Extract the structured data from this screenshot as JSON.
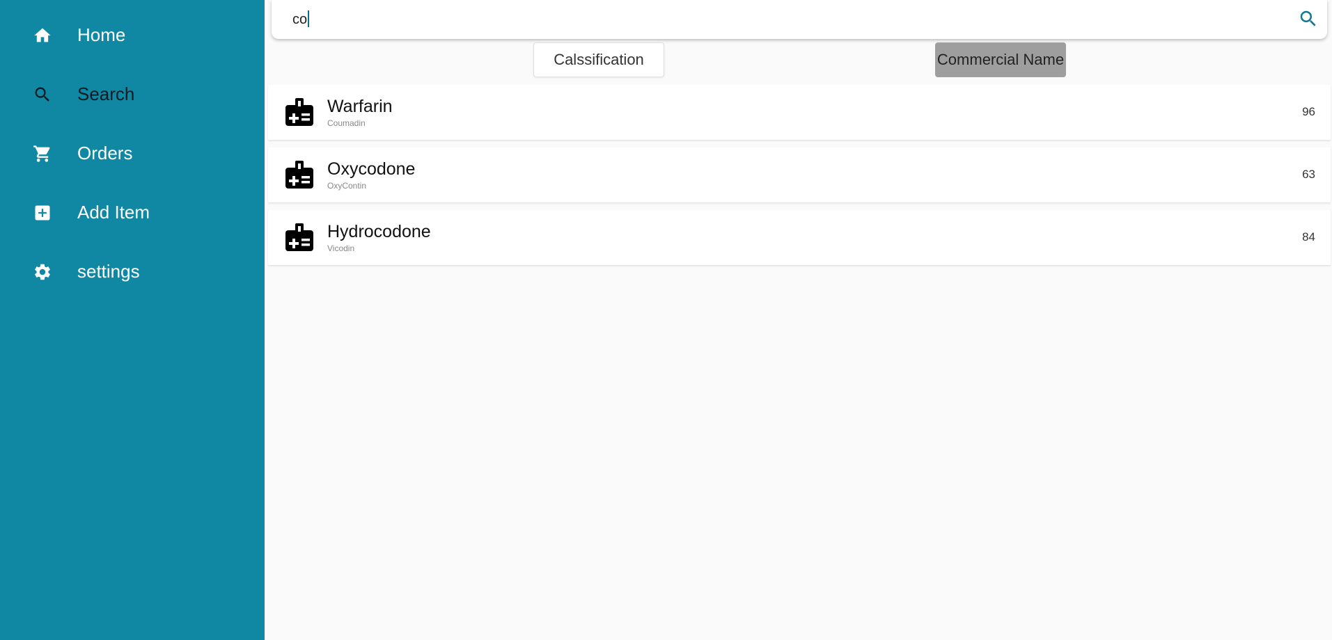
{
  "sidebar": {
    "background": "#1088a4",
    "items": [
      {
        "label": "Home",
        "icon": "home-icon"
      },
      {
        "label": "Search",
        "icon": "search-icon",
        "active": true
      },
      {
        "label": "Orders",
        "icon": "cart-icon"
      },
      {
        "label": "Add Item",
        "icon": "add-box-icon"
      },
      {
        "label": "settings",
        "icon": "gear-icon"
      }
    ]
  },
  "search": {
    "value": "co",
    "icon": "search-icon"
  },
  "filters": {
    "classification_label": "Calssification",
    "commercial_label": "Commercial Name",
    "selected": "Commercial Name"
  },
  "results": [
    {
      "name": "Warfarin",
      "commercial": "Coumadin",
      "count": "96",
      "icon": "medical-kit-icon"
    },
    {
      "name": "Oxycodone",
      "commercial": "OxyContin",
      "count": "63",
      "icon": "medical-kit-icon"
    },
    {
      "name": "Hydrocodone",
      "commercial": "Vicodin",
      "count": "84",
      "icon": "medical-kit-icon"
    }
  ]
}
